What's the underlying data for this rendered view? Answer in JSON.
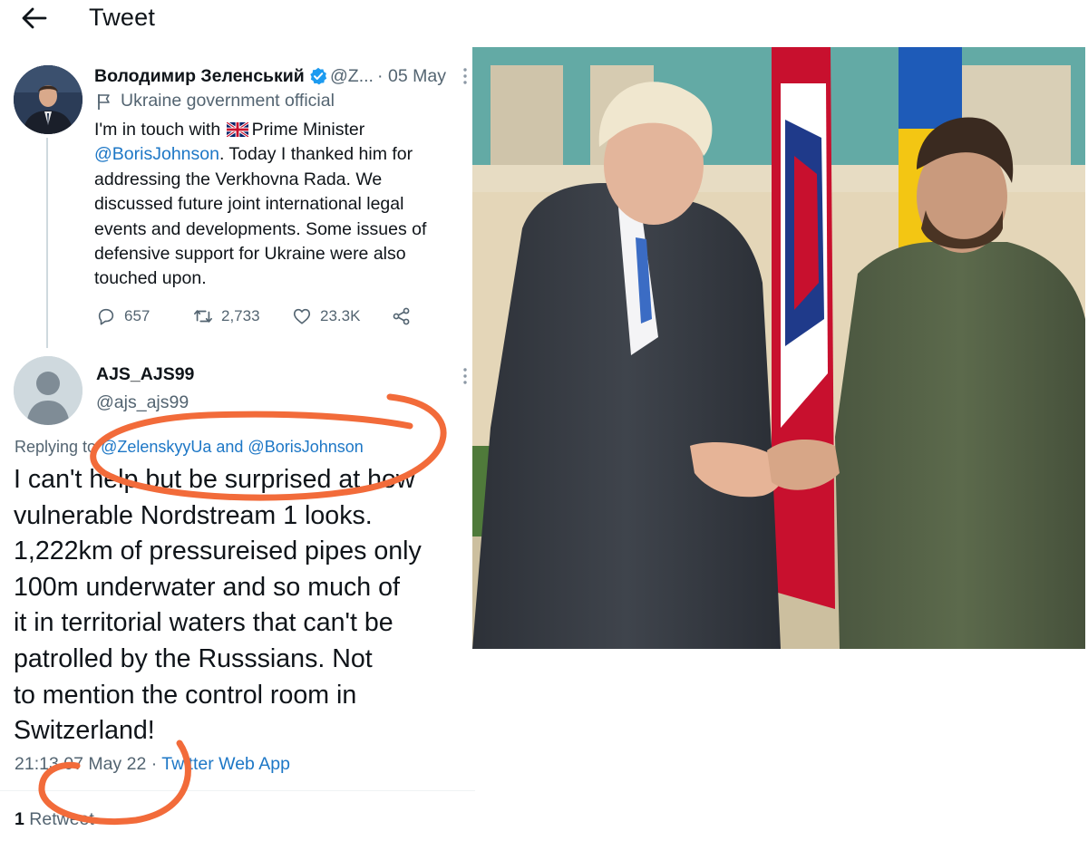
{
  "header": {
    "title": "Tweet",
    "back_icon": "arrow-left-icon"
  },
  "main_tweet": {
    "author_name": "Володимир Зеленський",
    "author_handle": "@Z...",
    "separator": "·",
    "date": "05 May",
    "affiliation": "Ukraine government official",
    "text_lines": [
      [
        "I'm in touch with ",
        "uk-flag",
        " Prime Minister"
      ],
      [
        "@BorisJohnson",
        ". Today I thanked him for"
      ],
      "addressing the Verkhovna Rada. We",
      "discussed future joint international legal",
      "events and developments. Some issues of",
      "defensive support for Ukraine were also",
      "touched upon."
    ],
    "line1_a": "I'm in touch with",
    "line1_b": "Prime Minister",
    "line2_mention": "@BorisJohnson",
    "line2_rest": ". Today I thanked him for",
    "line3": "addressing the Verkhovna Rada. We",
    "line4": "discussed future joint international legal",
    "line5": "events and developments. Some issues of",
    "line6": "defensive support for Ukraine were also",
    "line7": "touched upon.",
    "replies": "657",
    "retweets": "2,733",
    "likes": "23.3K",
    "icons": [
      "reply-icon",
      "retweet-icon",
      "like-icon",
      "share-icon",
      "verified-icon",
      "flag-icon"
    ]
  },
  "reply_tweet": {
    "author_name": "AJS_AJS99",
    "author_handle": "@ajs_ajs99",
    "replying_prefix": "Replying to",
    "replying_mentions": "@ZelenskyyUa and @BorisJohnson",
    "text_lines": [
      "I can't help but be surprised at how",
      "vulnerable Nordstream 1 looks.",
      "1,222km of pressureised pipes only",
      "100m underwater and so much of",
      "it in territorial waters that can't be",
      "patrolled by the Russsians. Not",
      "to mention the control room in",
      "Switzerland!"
    ],
    "time": "21:13",
    "date": "07 May 22",
    "separator": "·",
    "source": "Twitter Web App",
    "retweet_count": "1",
    "retweet_label": "Retweet"
  },
  "photo": {
    "subject": "handshake-photo"
  },
  "colors": {
    "text": "#0f1419",
    "secondary": "#536471",
    "link": "#1d77c6",
    "verified": "#1d9bf0",
    "annotation": "#f26b3a"
  }
}
